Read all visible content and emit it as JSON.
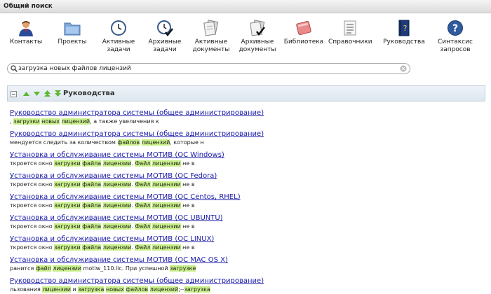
{
  "window": {
    "title": "Общий поиск"
  },
  "toolbar": {
    "items": [
      {
        "id": "contacts",
        "label": "Контакты",
        "icon": "person-icon"
      },
      {
        "id": "projects",
        "label": "Проекты",
        "icon": "folder-icon"
      },
      {
        "id": "active-tasks",
        "label": "Активные задачи",
        "icon": "clock-icon"
      },
      {
        "id": "archive-tasks",
        "label": "Архивные задачи",
        "icon": "clock-check-icon"
      },
      {
        "id": "active-docs",
        "label": "Активные документы",
        "icon": "documents-icon"
      },
      {
        "id": "archive-docs",
        "label": "Архивные документы",
        "icon": "documents-check-icon"
      },
      {
        "id": "library",
        "label": "Библиотека",
        "icon": "books-icon"
      },
      {
        "id": "references",
        "label": "Справочники",
        "icon": "list-icon"
      },
      {
        "id": "manuals",
        "label": "Руководства",
        "icon": "manual-book-icon"
      },
      {
        "id": "syntax",
        "label": "Синтаксис запросов",
        "icon": "help-icon"
      }
    ]
  },
  "search": {
    "value": "загрузка новых файлов лицензий",
    "placeholder": ""
  },
  "section": {
    "title": "Руководства"
  },
  "colors": {
    "accent": "#1a1aa8",
    "highlight": "#c9f08a",
    "header_bg": "#dde6ef"
  },
  "results": [
    {
      "title": "Руководство администратора системы (общее администрирование)",
      "snippet": [
        {
          "t": ", "
        },
        {
          "t": "загрузки",
          "h": true
        },
        {
          "t": " "
        },
        {
          "t": "новых",
          "h": true
        },
        {
          "t": " "
        },
        {
          "t": "лицензий",
          "h": true
        },
        {
          "t": ", а также увеличения к"
        }
      ]
    },
    {
      "title": "Руководство администратора системы (общее администрирование)",
      "snippet": [
        {
          "t": "мендуется следить за количеством "
        },
        {
          "t": "файлов",
          "h": true
        },
        {
          "t": " "
        },
        {
          "t": "лицензий",
          "h": true
        },
        {
          "t": ", которые н"
        }
      ]
    },
    {
      "title": "Установка и обслуживание системы МОТИВ (ОС Windows)",
      "snippet": [
        {
          "t": "ткроется окно "
        },
        {
          "t": "загрузки",
          "h": true
        },
        {
          "t": " "
        },
        {
          "t": "файла",
          "h": true
        },
        {
          "t": " "
        },
        {
          "t": "лицензии",
          "h": true
        },
        {
          "t": ". "
        },
        {
          "t": "Файл",
          "h": true
        },
        {
          "t": " "
        },
        {
          "t": "лицензии",
          "h": true
        },
        {
          "t": " не в"
        }
      ]
    },
    {
      "title": "Установка и обслуживание системы МОТИВ (ОС Fedora)",
      "snippet": [
        {
          "t": "ткроется окно "
        },
        {
          "t": "загрузки",
          "h": true
        },
        {
          "t": " "
        },
        {
          "t": "файла",
          "h": true
        },
        {
          "t": " "
        },
        {
          "t": "лицензии",
          "h": true
        },
        {
          "t": ". "
        },
        {
          "t": "Файл",
          "h": true
        },
        {
          "t": " "
        },
        {
          "t": "лицензии",
          "h": true
        },
        {
          "t": " не в"
        }
      ]
    },
    {
      "title": "Установка и обслуживание системы МОТИВ (ОС Centos, RHEL)",
      "snippet": [
        {
          "t": "ткроется окно "
        },
        {
          "t": "загрузки",
          "h": true
        },
        {
          "t": " "
        },
        {
          "t": "файла",
          "h": true
        },
        {
          "t": " "
        },
        {
          "t": "лицензии",
          "h": true
        },
        {
          "t": ". "
        },
        {
          "t": "Файл",
          "h": true
        },
        {
          "t": " "
        },
        {
          "t": "лицензии",
          "h": true
        },
        {
          "t": " не в"
        }
      ]
    },
    {
      "title": "Установка и обслуживание системы МОТИВ (ОС UBUNTU)",
      "snippet": [
        {
          "t": "ткроется окно "
        },
        {
          "t": "загрузки",
          "h": true
        },
        {
          "t": " "
        },
        {
          "t": "файла",
          "h": true
        },
        {
          "t": " "
        },
        {
          "t": "лицензии",
          "h": true
        },
        {
          "t": ". "
        },
        {
          "t": "Файл",
          "h": true
        },
        {
          "t": " "
        },
        {
          "t": "лицензии",
          "h": true
        },
        {
          "t": " не в"
        }
      ]
    },
    {
      "title": "Установка и обслуживание системы МОТИВ (ОС LINUX)",
      "snippet": [
        {
          "t": "ткроется окно "
        },
        {
          "t": "загрузки",
          "h": true
        },
        {
          "t": " "
        },
        {
          "t": "файла",
          "h": true
        },
        {
          "t": " "
        },
        {
          "t": "лицензии",
          "h": true
        },
        {
          "t": ". "
        },
        {
          "t": "Файл",
          "h": true
        },
        {
          "t": " "
        },
        {
          "t": "лицензии",
          "h": true
        },
        {
          "t": " не в"
        }
      ]
    },
    {
      "title": "Установка и обслуживание системы МОТИВ (ОС MAC OS X)",
      "snippet": [
        {
          "t": "ранится "
        },
        {
          "t": "файл",
          "h": true
        },
        {
          "t": " "
        },
        {
          "t": "лицензии",
          "h": true
        },
        {
          "t": " motiw_110.lic. При успешной "
        },
        {
          "t": "загрузке",
          "h": true
        }
      ]
    },
    {
      "title": "Руководство администратора системы (общее администрирование)",
      "snippet": [
        {
          "t": "льзования "
        },
        {
          "t": "лицензии",
          "h": true
        },
        {
          "t": " и "
        },
        {
          "t": "загрузка",
          "h": true
        },
        {
          "t": " "
        },
        {
          "t": "новых",
          "h": true
        },
        {
          "t": " "
        },
        {
          "t": "файлов",
          "h": true
        },
        {
          "t": " "
        },
        {
          "t": "лицензий",
          "h": true
        },
        {
          "t": ";--"
        },
        {
          "t": "загрузка",
          "h": true
        }
      ]
    }
  ]
}
